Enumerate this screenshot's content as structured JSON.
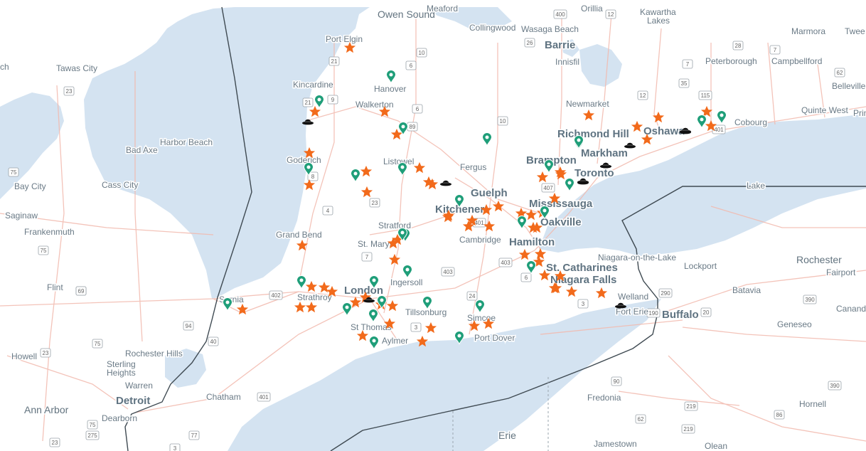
{
  "map": {
    "colors": {
      "land": "#ffffff",
      "water": "#d4e3f1",
      "border": "#3f4a52",
      "road": "#f2b9ad",
      "star": "#f26a1b",
      "pin": "#1f9e79",
      "hat": "#111111"
    },
    "labels": [
      {
        "text": "Owen Sound",
        "size": "mid"
      },
      {
        "text": "Meaford",
        "size": "small"
      },
      {
        "text": "Orillia",
        "size": "small"
      },
      {
        "text": "Kawartha",
        "size": "small"
      },
      {
        "text": "Lakes",
        "size": "small"
      },
      {
        "text": "Collingwood",
        "size": "small"
      },
      {
        "text": "Wasaga Beach",
        "size": "small"
      },
      {
        "text": "Barrie",
        "size": "big"
      },
      {
        "text": "Marmora",
        "size": "small"
      },
      {
        "text": "Twee",
        "size": "small"
      },
      {
        "text": "Port Elgin",
        "size": "small"
      },
      {
        "text": "Innisfil",
        "size": "small"
      },
      {
        "text": "Peterborough",
        "size": "small"
      },
      {
        "text": "Campbellford",
        "size": "small"
      },
      {
        "text": "Tawas City",
        "size": "small"
      },
      {
        "text": "ch",
        "size": "small"
      },
      {
        "text": "Hanover",
        "size": "small"
      },
      {
        "text": "Kincardine",
        "size": "small"
      },
      {
        "text": "Walkerton",
        "size": "small"
      },
      {
        "text": "Newmarket",
        "size": "small"
      },
      {
        "text": "Belleville",
        "size": "small"
      },
      {
        "text": "Quinte West",
        "size": "small"
      },
      {
        "text": "Prin",
        "size": "small"
      },
      {
        "text": "Richmond Hill",
        "size": "big"
      },
      {
        "text": "Oshawa",
        "size": "big"
      },
      {
        "text": "Cobourg",
        "size": "small"
      },
      {
        "text": "Harbor Beach",
        "size": "small"
      },
      {
        "text": "Bad Axe",
        "size": "small"
      },
      {
        "text": "Goderich",
        "size": "small"
      },
      {
        "text": "Markham",
        "size": "big"
      },
      {
        "text": "Listowel",
        "size": "small"
      },
      {
        "text": "Fergus",
        "size": "small"
      },
      {
        "text": "Brampton",
        "size": "big"
      },
      {
        "text": "Toronto",
        "size": "big"
      },
      {
        "text": "Bay City",
        "size": "small"
      },
      {
        "text": "Cass City",
        "size": "small"
      },
      {
        "text": "Guelph",
        "size": "big"
      },
      {
        "text": "Mississauga",
        "size": "big"
      },
      {
        "text": "Kitchener",
        "size": "big"
      },
      {
        "text": "Saginaw",
        "size": "small"
      },
      {
        "text": "Frankenmuth",
        "size": "small"
      },
      {
        "text": "Oakville",
        "size": "big"
      },
      {
        "text": "Stratford",
        "size": "small"
      },
      {
        "text": "Grand Bend",
        "size": "small"
      },
      {
        "text": "Cambridge",
        "size": "small"
      },
      {
        "text": "St. Marys",
        "size": "small"
      },
      {
        "text": "Hamilton",
        "size": "big"
      },
      {
        "text": "Niagara-on-the-Lake",
        "size": "small"
      },
      {
        "text": "Rochester",
        "size": "mid"
      },
      {
        "text": "St. Catharines",
        "size": "big"
      },
      {
        "text": "Lockport",
        "size": "small"
      },
      {
        "text": "Fairport",
        "size": "small"
      },
      {
        "text": "Ingersoll",
        "size": "small"
      },
      {
        "text": "Niagara Falls",
        "size": "big"
      },
      {
        "text": "Flint",
        "size": "small"
      },
      {
        "text": "London",
        "size": "big"
      },
      {
        "text": "Batavia",
        "size": "small"
      },
      {
        "text": "Strathroy",
        "size": "small"
      },
      {
        "text": "Sarnia",
        "size": "small"
      },
      {
        "text": "Welland",
        "size": "small"
      },
      {
        "text": "Tillsonburg",
        "size": "small"
      },
      {
        "text": "Fort Erie",
        "size": "small"
      },
      {
        "text": "Buffalo",
        "size": "big"
      },
      {
        "text": "Canand",
        "size": "small"
      },
      {
        "text": "Simcoe",
        "size": "small"
      },
      {
        "text": "St Thomas",
        "size": "small"
      },
      {
        "text": "Geneseo",
        "size": "small"
      },
      {
        "text": "Port Dover",
        "size": "small"
      },
      {
        "text": "Aylmer",
        "size": "small"
      },
      {
        "text": "Howell",
        "size": "small"
      },
      {
        "text": "Rochester Hills",
        "size": "small"
      },
      {
        "text": "Sterling",
        "size": "small"
      },
      {
        "text": "Heights",
        "size": "small"
      },
      {
        "text": "Warren",
        "size": "small"
      },
      {
        "text": "Chatham",
        "size": "small"
      },
      {
        "text": "Fredonia",
        "size": "small"
      },
      {
        "text": "Detroit",
        "size": "big"
      },
      {
        "text": "Ann Arbor",
        "size": "mid"
      },
      {
        "text": "Dearborn",
        "size": "small"
      },
      {
        "text": "Hornell",
        "size": "small"
      },
      {
        "text": "Erie",
        "size": "mid"
      },
      {
        "text": "Jamestown",
        "size": "small"
      },
      {
        "text": "Olean",
        "size": "small"
      },
      {
        "text": "Lake",
        "size": "small"
      }
    ],
    "shields": [
      "400",
      "12",
      "26",
      "10",
      "6",
      "21",
      "9",
      "89",
      "6",
      "10",
      "28",
      "7",
      "7",
      "62",
      "12",
      "35",
      "115",
      "401",
      "21",
      "8",
      "4",
      "23",
      "7",
      "403",
      "24",
      "3",
      "401",
      "403",
      "6",
      "407",
      "3",
      "402",
      "401",
      "75",
      "23",
      "75",
      "69",
      "94",
      "40",
      "23",
      "75",
      "275",
      "77",
      "3",
      "290",
      "190",
      "20",
      "390",
      "390",
      "219",
      "86",
      "62",
      "219",
      "90",
      "23",
      "75",
      "69"
    ],
    "markers": {
      "stars_count": 62,
      "pins_count": 34,
      "hats_count": 11
    }
  }
}
